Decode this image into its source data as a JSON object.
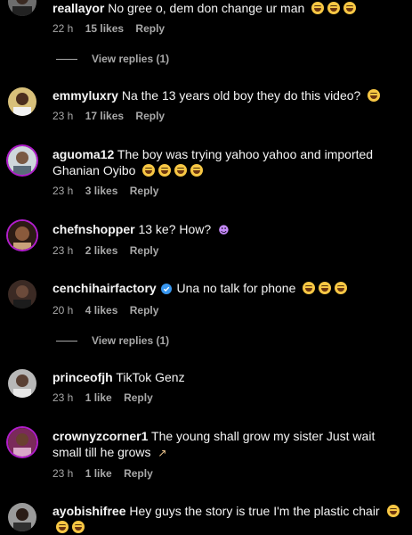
{
  "comments": [
    {
      "username": "reallayor",
      "text": "No gree o, dem don change ur man",
      "emojis": [
        "laugh-emoji",
        "laugh-emoji",
        "laugh-emoji"
      ],
      "time": "22 h",
      "likes": "15 likes",
      "reply": "Reply",
      "view_replies": "View replies (1)"
    },
    {
      "username": "emmyluxry",
      "text": "Na the 13 years old boy they do this video?",
      "emojis": [
        "sweat-smile-emoji"
      ],
      "time": "23 h",
      "likes": "17 likes",
      "reply": "Reply"
    },
    {
      "username": "aguoma12",
      "text": "The boy was trying yahoo yahoo and imported Ghanian Oyibo",
      "emojis": [
        "laugh-emoji",
        "laugh-emoji",
        "laugh-emoji",
        "laugh-emoji"
      ],
      "time": "23 h",
      "likes": "3 likes",
      "reply": "Reply"
    },
    {
      "username": "chefnshopper",
      "text": "13 ke? How?",
      "emojis": [
        "person-shrugging-emoji"
      ],
      "time": "23 h",
      "likes": "2 likes",
      "reply": "Reply"
    },
    {
      "username": "cenchihairfactory",
      "verified": true,
      "text": "Una no talk for phone",
      "emojis": [
        "laugh-emoji",
        "laugh-emoji",
        "laugh-emoji"
      ],
      "time": "20 h",
      "likes": "4 likes",
      "reply": "Reply",
      "view_replies": "View replies (1)"
    },
    {
      "username": "princeofjh",
      "text": "TikTok Genz",
      "emojis": [],
      "time": "23 h",
      "likes": "1 like",
      "reply": "Reply"
    },
    {
      "username": "crownyzcorner1",
      "text": "The young shall grow my sister Just wait small till he grows",
      "emojis": [
        "person-running-emoji"
      ],
      "time": "23 h",
      "likes": "1 like",
      "reply": "Reply"
    },
    {
      "username": "ayobishifree",
      "text": "Hey guys the story is true I'm the plastic chair",
      "emojis": [
        "laugh-emoji",
        "laugh-emoji",
        "laugh-emoji"
      ]
    }
  ],
  "colors": {
    "background": "#000000",
    "text": "#f5f5f5",
    "secondary": "#a8a8a8",
    "verified": "#3897f0",
    "story_ring": "#b11ecb"
  }
}
